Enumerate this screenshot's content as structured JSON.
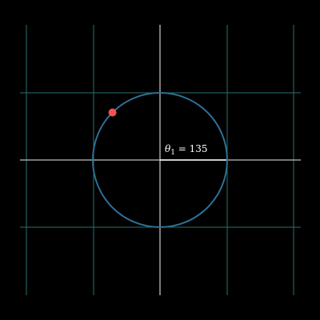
{
  "diagram": {
    "background_color": "#000000",
    "grid_color": "#2b6f6f",
    "axis_color": "#bfbfbf",
    "circle_color": "#2f6f96",
    "point_color": "#f0544f",
    "radius_line_color": "#ffffff",
    "angle_label": {
      "symbol": "θ",
      "subscript": "1",
      "equals": " = ",
      "value": "135"
    },
    "angle_degrees": 135
  }
}
